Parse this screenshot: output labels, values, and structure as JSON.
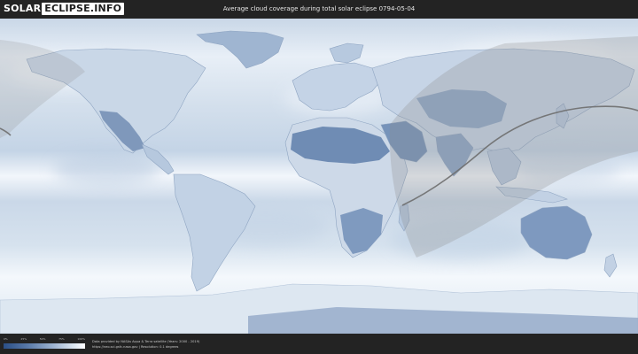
{
  "logo": {
    "part1": "SOLAR",
    "part2": "ECLIPSE.INFO"
  },
  "title": "Average cloud coverage during total solar eclipse 0794-05-04",
  "legend": {
    "ticks": [
      "0%",
      "25%",
      "50%",
      "75%",
      "100%"
    ],
    "colors": {
      "clear": "#2b4f86",
      "mid": "#9bb1cf",
      "overcast": "#ffffff"
    }
  },
  "credits": {
    "line1": "Data provided by NASAs Aqua & Terra satellite (Years: 2000 - 2019)",
    "line2": "https://neo.sci.gsfc.nasa.gov  |  Resolution: 0.1 degrees"
  },
  "colors": {
    "background": "#232323",
    "map_base": "#dde7f1",
    "clear_sky": "#5f7ea8",
    "eclipse_path": "#707070",
    "penumbra": "#9a9a9a"
  }
}
